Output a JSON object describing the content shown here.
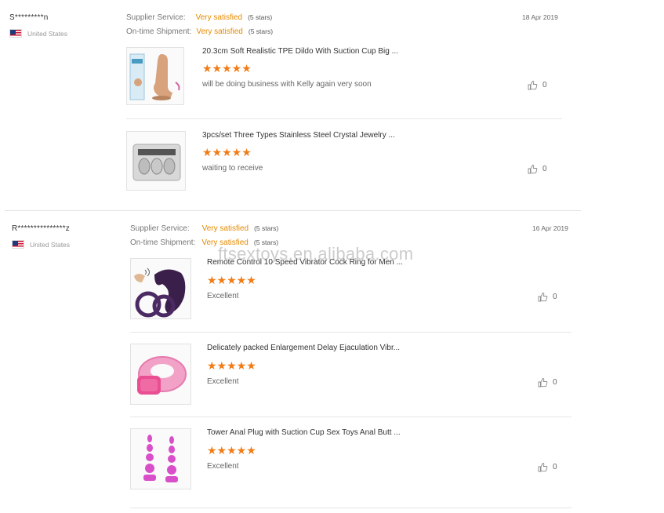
{
  "watermark": "ftsextoys.en.alibaba.com",
  "reviews": [
    {
      "buyer": "S*********n",
      "country": "United States",
      "date": "18 Apr 2019",
      "supplier_label": "Supplier Service:",
      "supplier_value": "Very satisfied",
      "supplier_stars": "(5 stars)",
      "shipment_label": "On-time Shipment:",
      "shipment_value": "Very satisfied",
      "shipment_stars": "(5 stars)",
      "items": [
        {
          "title": "20.3cm Soft Realistic TPE Dildo With Suction Cup Big ...",
          "stars": "★★★★★",
          "comment": "will be doing business with Kelly again very soon",
          "likes": "0"
        },
        {
          "title": "3pcs/set Three Types Stainless Steel Crystal Jewelry ...",
          "stars": "★★★★★",
          "comment": "waiting to receive",
          "likes": "0"
        }
      ]
    },
    {
      "buyer": "R***************z",
      "country": "United States",
      "date": "16 Apr 2019",
      "supplier_label": "Supplier Service:",
      "supplier_value": "Very satisfied",
      "supplier_stars": "(5 stars)",
      "shipment_label": "On-time Shipment:",
      "shipment_value": "Very satisfied",
      "shipment_stars": "(5 stars)",
      "items": [
        {
          "title": "Remote Control 10 Speed Vibrator Cock Ring for Men ...",
          "stars": "★★★★★",
          "comment": "Excellent",
          "likes": "0"
        },
        {
          "title": "Delicately packed Enlargement Delay Ejaculation Vibr...",
          "stars": "★★★★★",
          "comment": "Excellent",
          "likes": "0"
        },
        {
          "title": "Tower Anal Plug with Suction Cup Sex Toys Anal Butt ...",
          "stars": "★★★★★",
          "comment": "Excellent",
          "likes": "0"
        }
      ]
    }
  ]
}
